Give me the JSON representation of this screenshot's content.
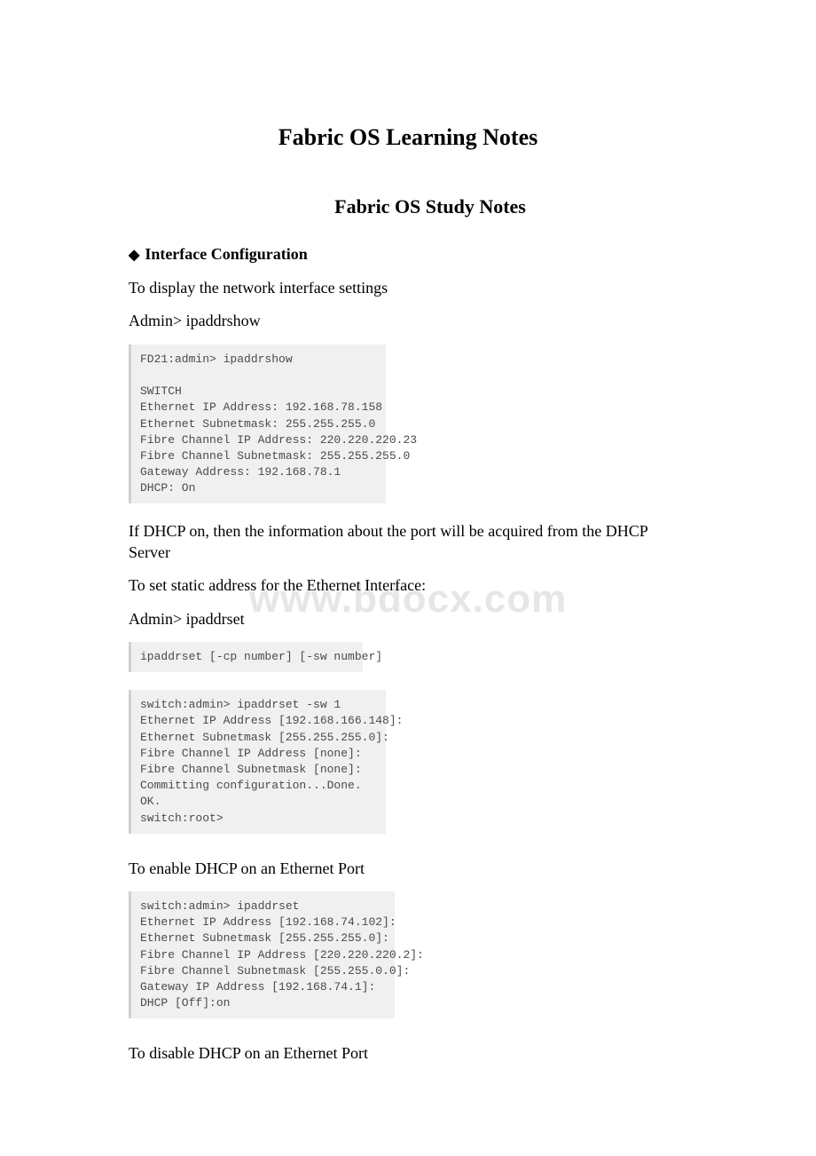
{
  "watermark": "www.bdocx.com",
  "title": "Fabric OS Learning Notes",
  "subtitle": "Fabric OS Study Notes",
  "section1": {
    "heading": "Interface Configuration",
    "p1": "To display the network interface settings",
    "p2": "Admin> ipaddrshow",
    "code1": "FD21:admin> ipaddrshow\n\nSWITCH\nEthernet IP Address: 192.168.78.158\nEthernet Subnetmask: 255.255.255.0\nFibre Channel IP Address: 220.220.220.23\nFibre Channel Subnetmask: 255.255.255.0\nGateway Address: 192.168.78.1\nDHCP: On",
    "p3": "If DHCP on, then the information about the port will be acquired from the DHCP Server",
    "p4": "To set static address for the Ethernet Interface:",
    "p5": "Admin> ipaddrset",
    "code2": "ipaddrset [-cp number] [-sw number]",
    "code3": "switch:admin> ipaddrset -sw 1\nEthernet IP Address [192.168.166.148]:\nEthernet Subnetmask [255.255.255.0]:\nFibre Channel IP Address [none]:\nFibre Channel Subnetmask [none]:\nCommitting configuration...Done.\nOK.\nswitch:root>",
    "p6": "To enable DHCP on an Ethernet Port",
    "code4": "switch:admin> ipaddrset\nEthernet IP Address [192.168.74.102]:\nEthernet Subnetmask [255.255.255.0]:\nFibre Channel IP Address [220.220.220.2]:\nFibre Channel Subnetmask [255.255.0.0]:\nGateway IP Address [192.168.74.1]:\nDHCP [Off]:on",
    "p7": "To disable DHCP on an Ethernet Port"
  }
}
